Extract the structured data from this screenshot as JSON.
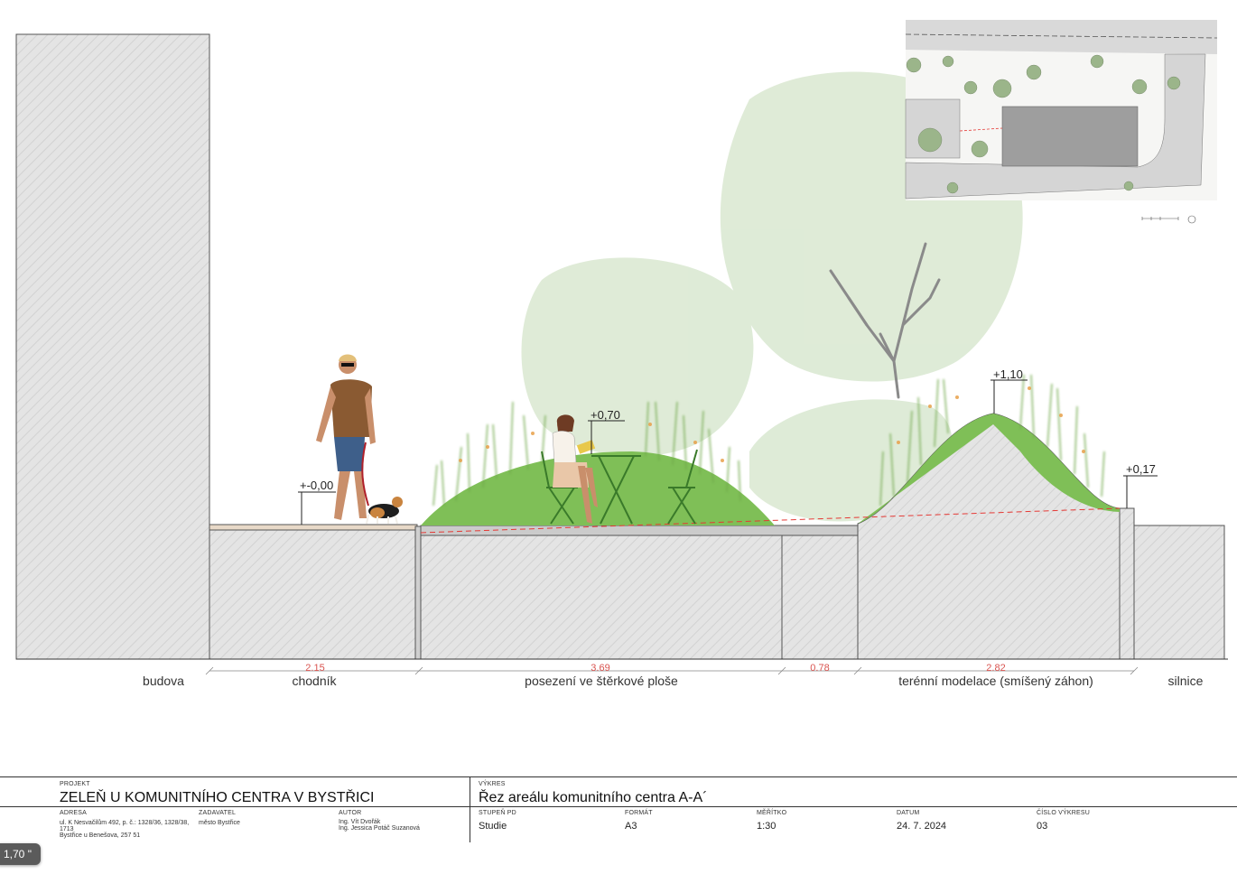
{
  "levels": {
    "chodnik": "+-0,00",
    "seating": "+0,70",
    "mound": "+1,10",
    "road_edge": "+0,17"
  },
  "dimensions": {
    "d1": "2.15",
    "d2": "3.69",
    "d3": "0.78",
    "d4": "2.82"
  },
  "zones": {
    "budova": "budova",
    "chodnik": "chodník",
    "seating": "posezení ve štěrkové ploše",
    "mound": "terénní modelace (smíšený záhon)",
    "road": "silnice"
  },
  "colors": {
    "grass": "#7fbf57",
    "tree_canopy": "#dbe9d3",
    "ground_hatch": "#d4d4d4",
    "dimension_red": "#d9534f",
    "sight_line": "#e53935"
  },
  "title_block": {
    "project_label": "PROJEKT",
    "project_name": "ZELEŇ U KOMUNITNÍHO CENTRA V BYSTŘICI",
    "drawing_label": "VÝKRES",
    "drawing_name": "Řez areálu komunitního centra A-A´",
    "address_label": "ADRESA",
    "address_line1": "ul. K Nesvačilům 492, p. č.: 1328/36, 1328/38,",
    "address_line2": "1713",
    "address_line3": "Bystřice u Benešova, 257 51",
    "client_label": "ZADAVATEL",
    "client_value": "město Bystřice",
    "author_label": "AUTOR",
    "author_line1": "Ing. Vít Dvořák",
    "author_line2": "Ing. Jessica Potáč Suzanová",
    "stage_label": "STUPEŇ PD",
    "stage_value": "Studie",
    "format_label": "FORMÁT",
    "format_value": "A3",
    "scale_label": "MĚŘÍTKO",
    "scale_value": "1:30",
    "date_label": "DATUM",
    "date_value": "24. 7. 2024",
    "sheet_label": "ČÍSLO VÝKRESU",
    "sheet_value": "03"
  },
  "zoom_indicator": "1,70 \""
}
